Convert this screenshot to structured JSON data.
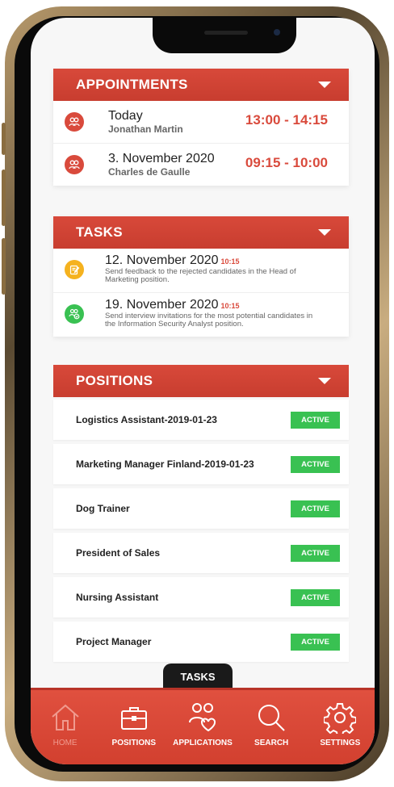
{
  "appointments": {
    "title": "APPOINTMENTS",
    "items": [
      {
        "date": "Today",
        "name": "Jonathan Martin",
        "time": "13:00 - 14:15"
      },
      {
        "date": "3. November 2020",
        "name": "Charles de Gaulle",
        "time": "09:15 - 10:00"
      }
    ]
  },
  "tasks": {
    "title": "TASKS",
    "items": [
      {
        "date": "12. November 2020",
        "time": "10:15",
        "desc": "Send feedback to the rejected candidates in the Head of Marketing position.",
        "color": "#f5b21f"
      },
      {
        "date": "19. November 2020",
        "time": "10:15",
        "desc": "Send interview invitations for the most potential candidates in the Information Security Analyst position.",
        "color": "#39c152"
      }
    ]
  },
  "positions": {
    "title": "POSITIONS",
    "items": [
      {
        "name": "Logistics Assistant-2019-01-23",
        "status": "ACTIVE"
      },
      {
        "name": "Marketing Manager Finland-2019-01-23",
        "status": "ACTIVE"
      },
      {
        "name": "Dog Trainer",
        "status": "ACTIVE"
      },
      {
        "name": "President of Sales",
        "status": "ACTIVE"
      },
      {
        "name": "Nursing Assistant",
        "status": "ACTIVE"
      },
      {
        "name": "Project Manager",
        "status": "ACTIVE"
      }
    ]
  },
  "tasks_tab": "TASKS",
  "nav": {
    "home": "HOME",
    "positions": "POSITIONS",
    "applications": "APPLICATIONS",
    "search": "SEARCH",
    "settings": "SETTINGS"
  },
  "colors": {
    "accent": "#d94a3c",
    "active": "#39c152"
  }
}
